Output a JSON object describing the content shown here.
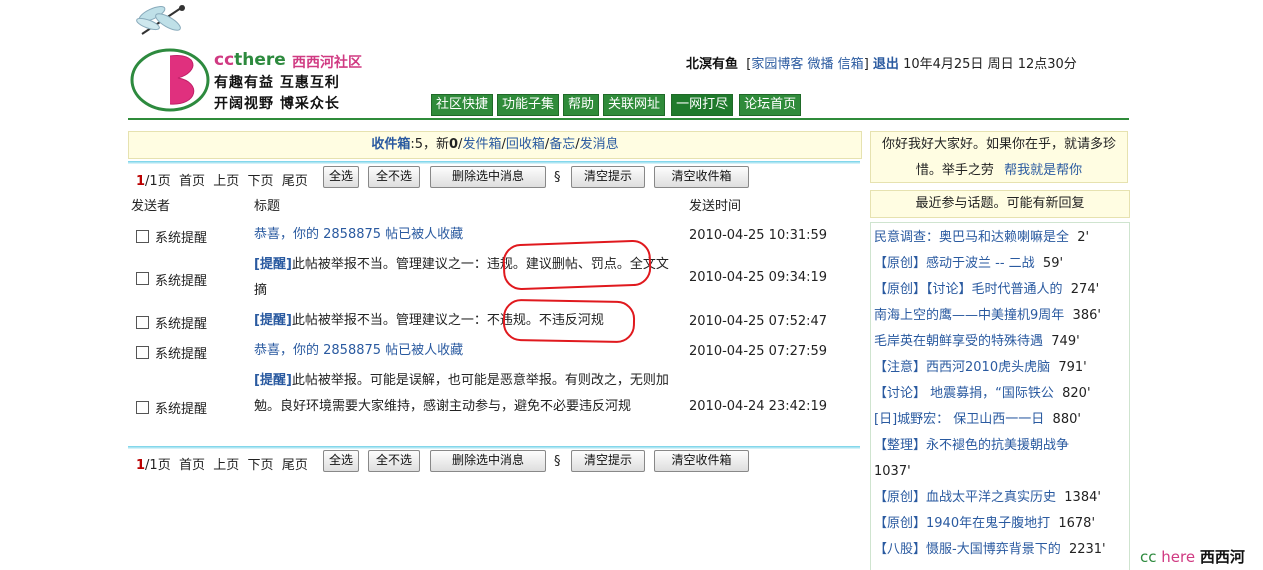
{
  "header": {
    "brand_cc": "cc",
    "brand_there": "there",
    "brand_cn": "西西河社区",
    "slogan1": "有趣有益 互惠互利",
    "slogan2": "开阔视野 博采众长",
    "user": {
      "name": "北溟有鱼",
      "bracket_open": "[",
      "blog": "家园博客",
      "weibo": "微播",
      "mailbox": "信箱",
      "bracket_close": "]",
      "logout": "退出",
      "date": "10年4月25日",
      "weekday": "周日",
      "time": "12点30分"
    },
    "nav": [
      "社区快捷",
      "功能子集",
      "帮助",
      "关联网址",
      "一网打尽",
      "论坛首页"
    ]
  },
  "inbox": {
    "title": "收件箱",
    "count_text": ":5，新",
    "new_count": "0",
    "sep": "/",
    "links": [
      "发件箱",
      "回收箱",
      "备忘",
      "发消息"
    ]
  },
  "toolbar": {
    "page_cur": "1",
    "page_total_text": "/1页",
    "first": "首页",
    "prev": "上页",
    "next": "下页",
    "last": "尾页",
    "select_all": "全选",
    "select_none": "全不选",
    "delete_selected": "删除选中消息",
    "section": "§",
    "clear_hints": "清空提示",
    "clear_inbox": "清空收件箱"
  },
  "table": {
    "headers": {
      "sender": "发送者",
      "subject": "标题",
      "time": "发送时间"
    },
    "rows": [
      {
        "sender": "系统提醒",
        "tag": "",
        "subject": "恭喜，你的  2858875 帖已被人收藏",
        "time": "2010-04-25 10:31:59"
      },
      {
        "sender": "系统提醒",
        "tag": "[提醒]",
        "subject": "此帖被举报不当。管理建议之一：违规。建议删帖、罚点。全文文摘",
        "time": "2010-04-25 09:34:19"
      },
      {
        "sender": "系统提醒",
        "tag": "[提醒]",
        "subject": "此帖被举报不当。管理建议之一：不违规。不违反河规",
        "time": "2010-04-25 07:52:47"
      },
      {
        "sender": "系统提醒",
        "tag": "",
        "subject": "恭喜，你的  2858875 帖已被人收藏",
        "time": "2010-04-25 07:27:59"
      },
      {
        "sender": "系统提醒",
        "tag": "[提醒]",
        "subject": "此帖被举报。可能是误解，也可能是恶意举报。有则改之，无则加勉。良好环境需要大家维持，感谢主动参与，避免不必要违反河规",
        "time": "2010-04-24 23:42:19"
      }
    ]
  },
  "sidebar": {
    "greeting": "你好我好大家好。如果你在乎，就请多珍惜。举手之劳",
    "help_link": "帮我就是帮你",
    "recent_title": "最近参与话题。可能有新回复",
    "topics": [
      {
        "title": "民意调查：奥巴马和达赖喇嘛是全",
        "count": "2'"
      },
      {
        "title": "【原创】感动于波兰 -- 二战",
        "count": "59'"
      },
      {
        "title": "【原创】【讨论】毛时代普通人的",
        "count": "274'"
      },
      {
        "title": "南海上空的鹰——中美撞机9周年",
        "count": "386'"
      },
      {
        "title": "毛岸英在朝鲜享受的特殊待遇",
        "count": "749'"
      },
      {
        "title": "【注意】西西河2010虎头虎脑",
        "count": "791'"
      },
      {
        "title": "【讨论】 地震募捐，“国际铁公",
        "count": "820'"
      },
      {
        "title": "[日]城野宏： 保卫山西一一日",
        "count": "880'"
      },
      {
        "title": "【整理】永不褪色的抗美援朝战争",
        "count": "1037'"
      },
      {
        "title": "【原创】血战太平洋之真实历史",
        "count": "1384'"
      },
      {
        "title": "【原创】1940年在鬼子腹地打",
        "count": "1678'"
      },
      {
        "title": "【八股】慑服-大国博弈背景下的",
        "count": "2231'"
      }
    ]
  },
  "footer": {
    "c1": "cc",
    "c2": "here",
    "c3": "西西河"
  },
  "colors": {
    "accent_green": "#2f8b3a",
    "link_blue": "#2a5aa0",
    "brand_pink": "#d03a82",
    "annotation_red": "#e0191e"
  }
}
